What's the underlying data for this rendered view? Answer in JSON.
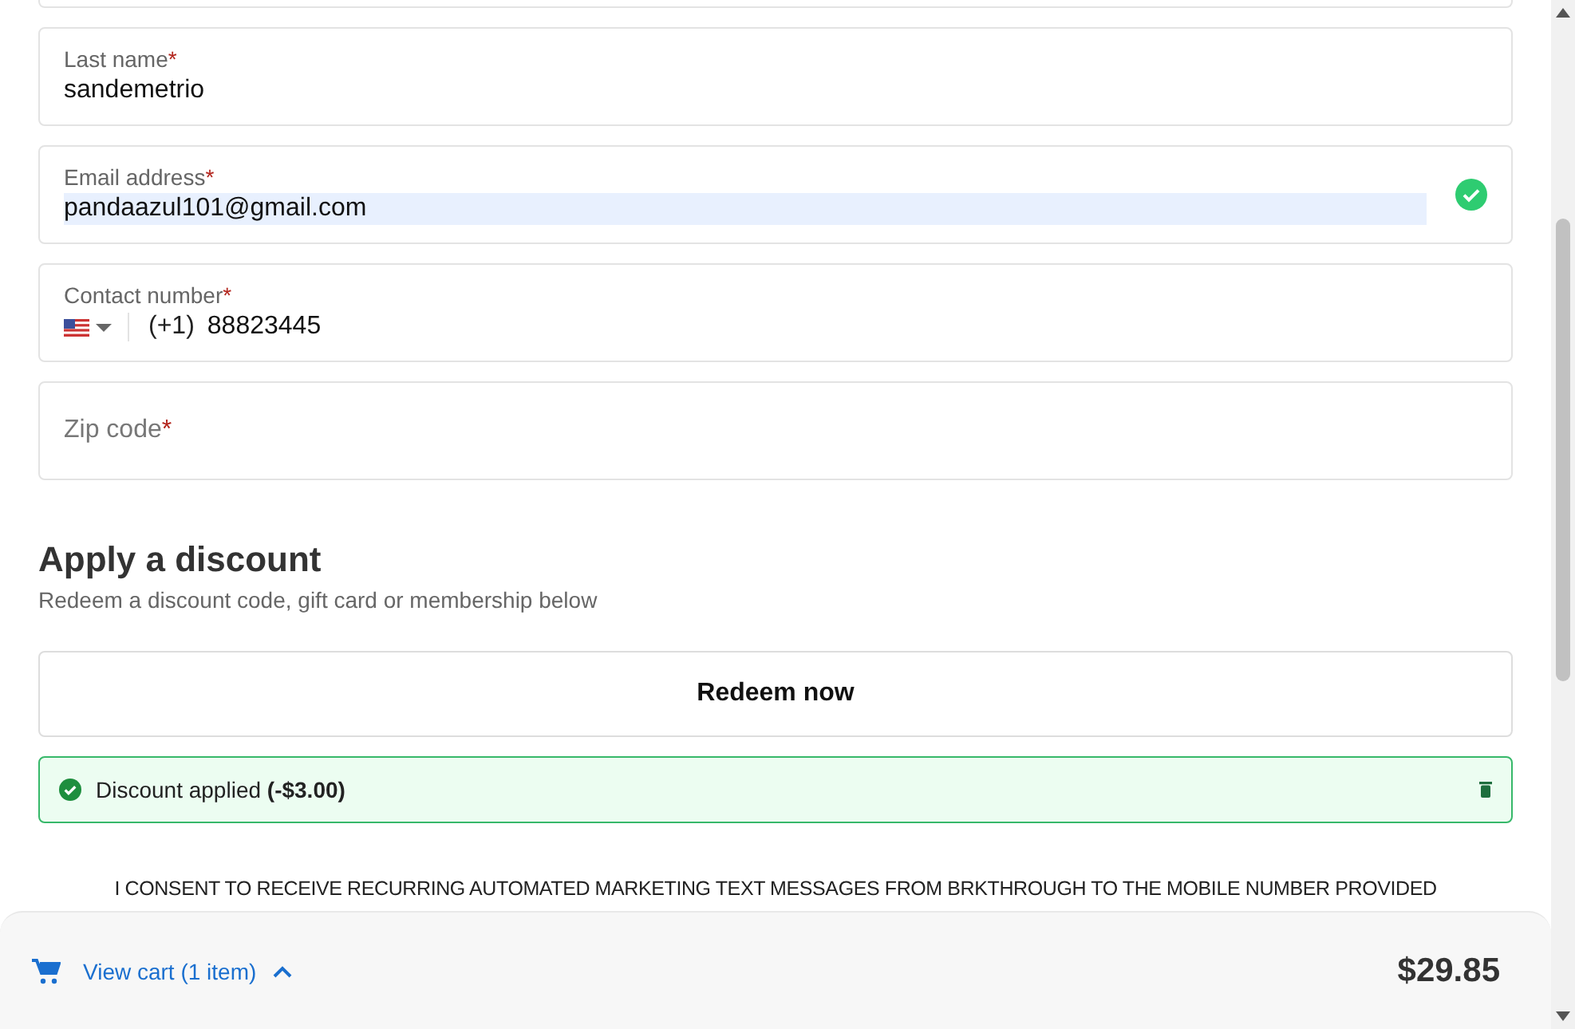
{
  "fields": [
    {
      "kind": "text",
      "label": "Last name",
      "required_mark": "*",
      "value": "sandemetrio"
    },
    {
      "kind": "text",
      "label": "Email address",
      "required_mark": "*",
      "value": "pandaazul101@gmail.com",
      "autofilled": true,
      "valid": true
    },
    {
      "kind": "phone",
      "label": "Contact number",
      "required_mark": "*",
      "dial_code": "(+1)",
      "value": "88823445"
    },
    {
      "kind": "empty",
      "placeholder": "Zip code",
      "required_mark": "*"
    }
  ],
  "discount": {
    "title": "Apply a discount",
    "subtitle": "Redeem a discount code, gift card or membership below",
    "button": "Redeem now",
    "applied_text": "Discount applied **(-$3.00)**"
  },
  "consent": "I CONSENT TO RECEIVE RECURRING AUTOMATED MARKETING TEXT MESSAGES FROM BRKTHROUGH TO THE MOBILE NUMBER PROVIDED",
  "cart": {
    "link": "View cart (1 item)",
    "total": "$29.85",
    "expanded": false
  }
}
